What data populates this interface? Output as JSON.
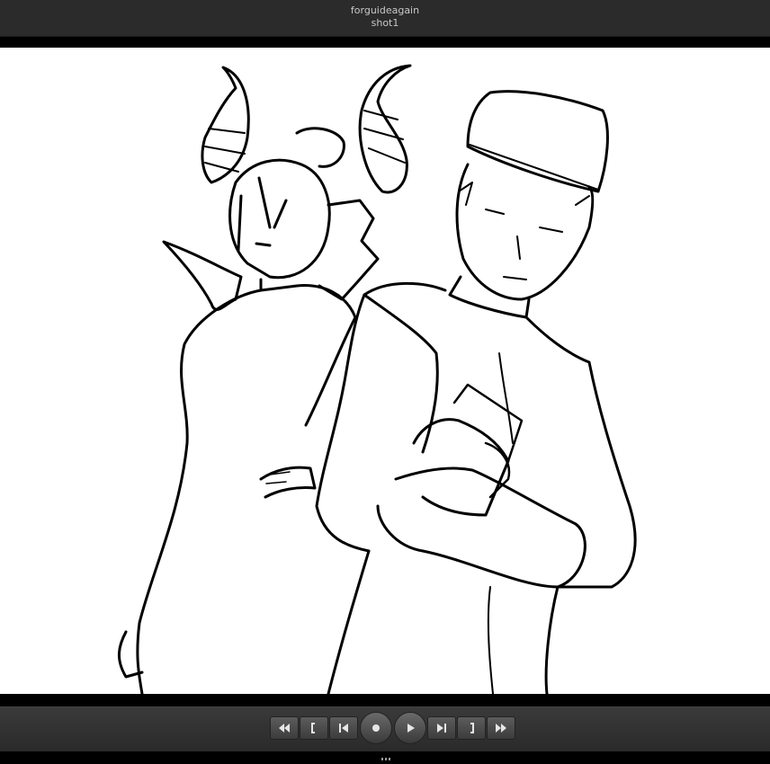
{
  "window": {
    "title": "forguideagain",
    "subtitle": "shot1"
  },
  "viewport": {
    "content": "line-art-sketch",
    "background_color": "#ffffff"
  },
  "playback_controls": {
    "buttons": [
      {
        "name": "rewind-button",
        "icon": "rewind-icon"
      },
      {
        "name": "mark-in-button",
        "icon": "bracket-left-icon"
      },
      {
        "name": "previous-frame-button",
        "icon": "step-back-icon"
      },
      {
        "name": "record-button",
        "icon": "record-icon"
      },
      {
        "name": "play-button",
        "icon": "play-icon"
      },
      {
        "name": "next-frame-button",
        "icon": "step-forward-icon"
      },
      {
        "name": "mark-out-button",
        "icon": "bracket-right-icon"
      },
      {
        "name": "fast-forward-button",
        "icon": "fast-forward-icon"
      }
    ]
  },
  "colors": {
    "chrome": "#2b2b2b",
    "button": "#4a4a4a",
    "icon": "#e6e6e6"
  }
}
